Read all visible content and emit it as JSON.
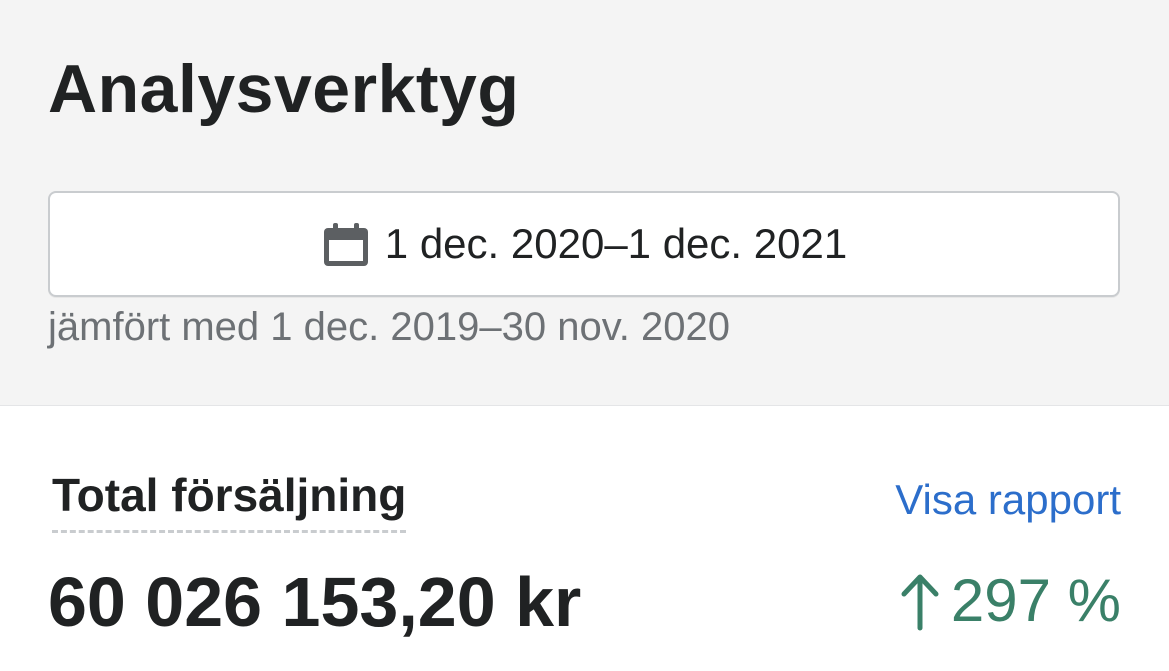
{
  "header": {
    "title": "Analysverktyg"
  },
  "date_range": {
    "icon": "calendar-icon",
    "label": "1 dec. 2020–1 dec. 2021",
    "comparison": "jämfört med 1 dec. 2019–30 nov. 2020"
  },
  "metric": {
    "title": "Total försäljning",
    "link_label": "Visa rapport",
    "value": "60 026 153,20 kr",
    "change_icon": "arrow-up-icon",
    "change": "297 %"
  },
  "colors": {
    "background": "#f4f4f4",
    "card": "#ffffff",
    "text": "#202223",
    "muted_text": "#6d7175",
    "link": "#2c6ecb",
    "positive": "#3a8068"
  }
}
